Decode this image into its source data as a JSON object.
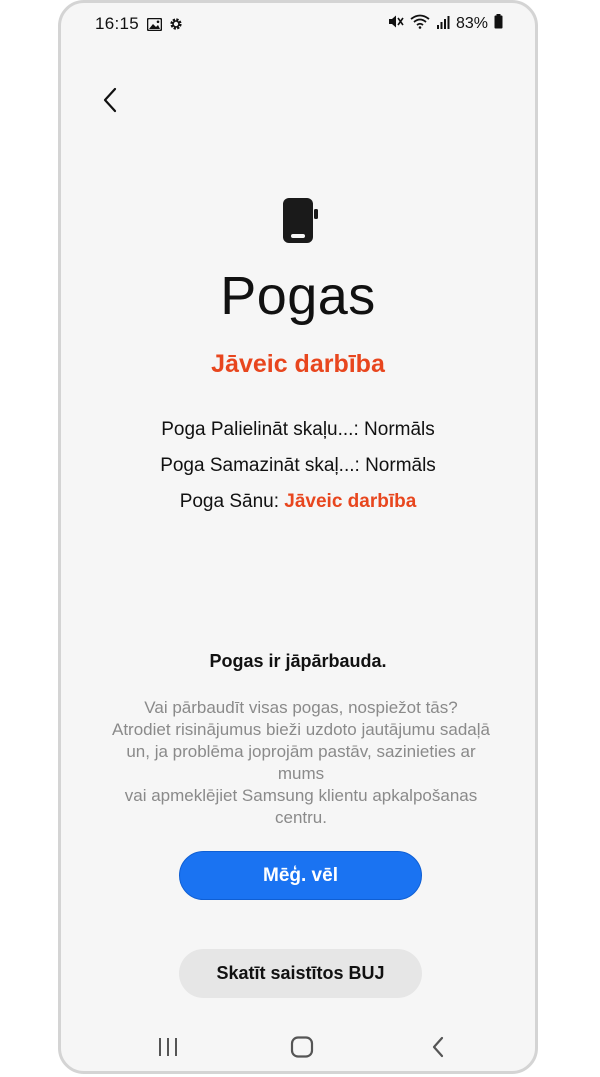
{
  "status_bar": {
    "time": "16:15",
    "battery": "83%",
    "icons_left": [
      "image-icon",
      "gear-icon"
    ],
    "icons_right": [
      "mute-icon",
      "wifi-icon",
      "signal-icon",
      "battery-icon"
    ]
  },
  "nav": {
    "back_icon": "chevron-left-icon"
  },
  "header": {
    "device_icon": "phone-side-button-icon",
    "title": "Pogas",
    "status": "Jāveic darbība"
  },
  "results": [
    {
      "label": "Poga Palielināt skaļu...: ",
      "value": "Normāls",
      "state": "normal"
    },
    {
      "label": "Poga Samazināt skaļ...: ",
      "value": "Normāls",
      "state": "normal"
    },
    {
      "label": "Poga Sānu: ",
      "value": "Jāveic darbība",
      "state": "warning"
    }
  ],
  "check": {
    "title": "Pogas ir jāpārbauda.",
    "lines": [
      "Vai pārbaudīt visas pogas, nospiežot tās?",
      "Atrodiet risinājumus bieži uzdoto jautājumu sadaļā",
      "un, ja problēma joprojām pastāv, sazinieties ar mums",
      "vai apmeklējiet Samsung klientu apkalpošanas",
      "centru."
    ]
  },
  "actions": {
    "retry_label": "Mēģ. vēl",
    "faq_label": "Skatīt saistītos BUJ"
  },
  "system_nav": {
    "recents_icon": "recents-icon",
    "home_icon": "home-icon",
    "back_icon": "back-icon"
  },
  "colors": {
    "accent": "#1a73f2",
    "warning": "#e8461e",
    "background": "#f6f6f6"
  }
}
